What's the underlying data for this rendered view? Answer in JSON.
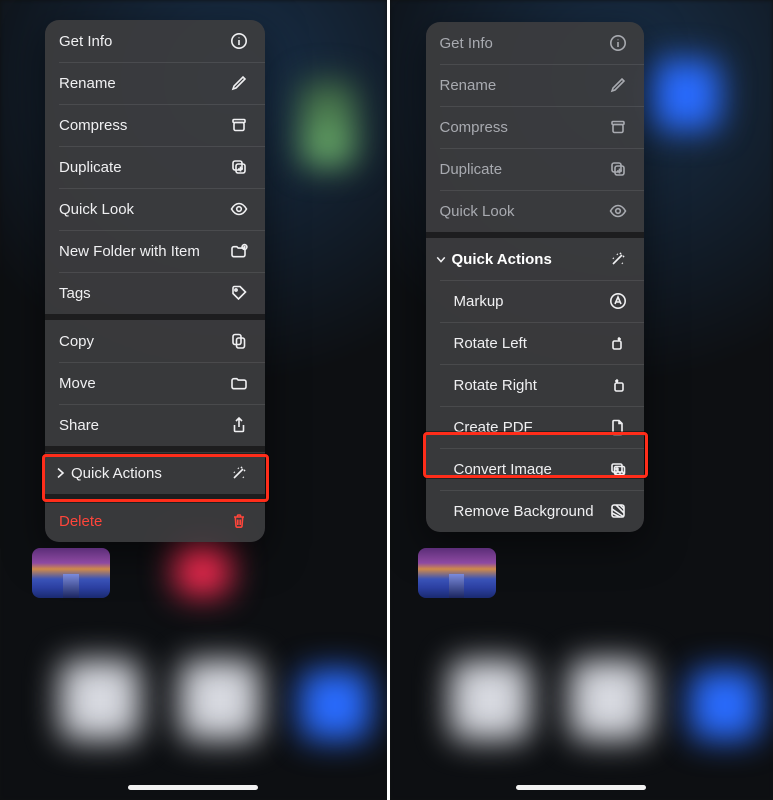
{
  "colors": {
    "danger": "#ff453a",
    "highlight": "#ff2d1a"
  },
  "left": {
    "sections": {
      "info": {
        "getinfo": {
          "label": "Get Info"
        },
        "rename": {
          "label": "Rename"
        },
        "compress": {
          "label": "Compress"
        },
        "duplicate": {
          "label": "Duplicate"
        },
        "quicklook": {
          "label": "Quick Look"
        },
        "newfolder": {
          "label": "New Folder with Item"
        },
        "tags": {
          "label": "Tags"
        }
      },
      "file": {
        "copy": {
          "label": "Copy"
        },
        "move": {
          "label": "Move"
        },
        "share": {
          "label": "Share"
        }
      },
      "qa": {
        "quickactions": {
          "label": "Quick Actions",
          "highlighted": true
        }
      },
      "danger": {
        "delete": {
          "label": "Delete"
        }
      }
    }
  },
  "right": {
    "sections": {
      "info": {
        "getinfo": {
          "label": "Get Info"
        },
        "rename": {
          "label": "Rename"
        },
        "compress": {
          "label": "Compress"
        },
        "duplicate": {
          "label": "Duplicate"
        },
        "quicklook": {
          "label": "Quick Look"
        }
      },
      "qa": {
        "header": {
          "label": "Quick Actions"
        },
        "markup": {
          "label": "Markup"
        },
        "rotateleft": {
          "label": "Rotate Left"
        },
        "rotateright": {
          "label": "Rotate Right"
        },
        "createpdf": {
          "label": "Create PDF"
        },
        "convertimage": {
          "label": "Convert Image",
          "highlighted": true
        },
        "removebg": {
          "label": "Remove Background"
        }
      }
    }
  }
}
